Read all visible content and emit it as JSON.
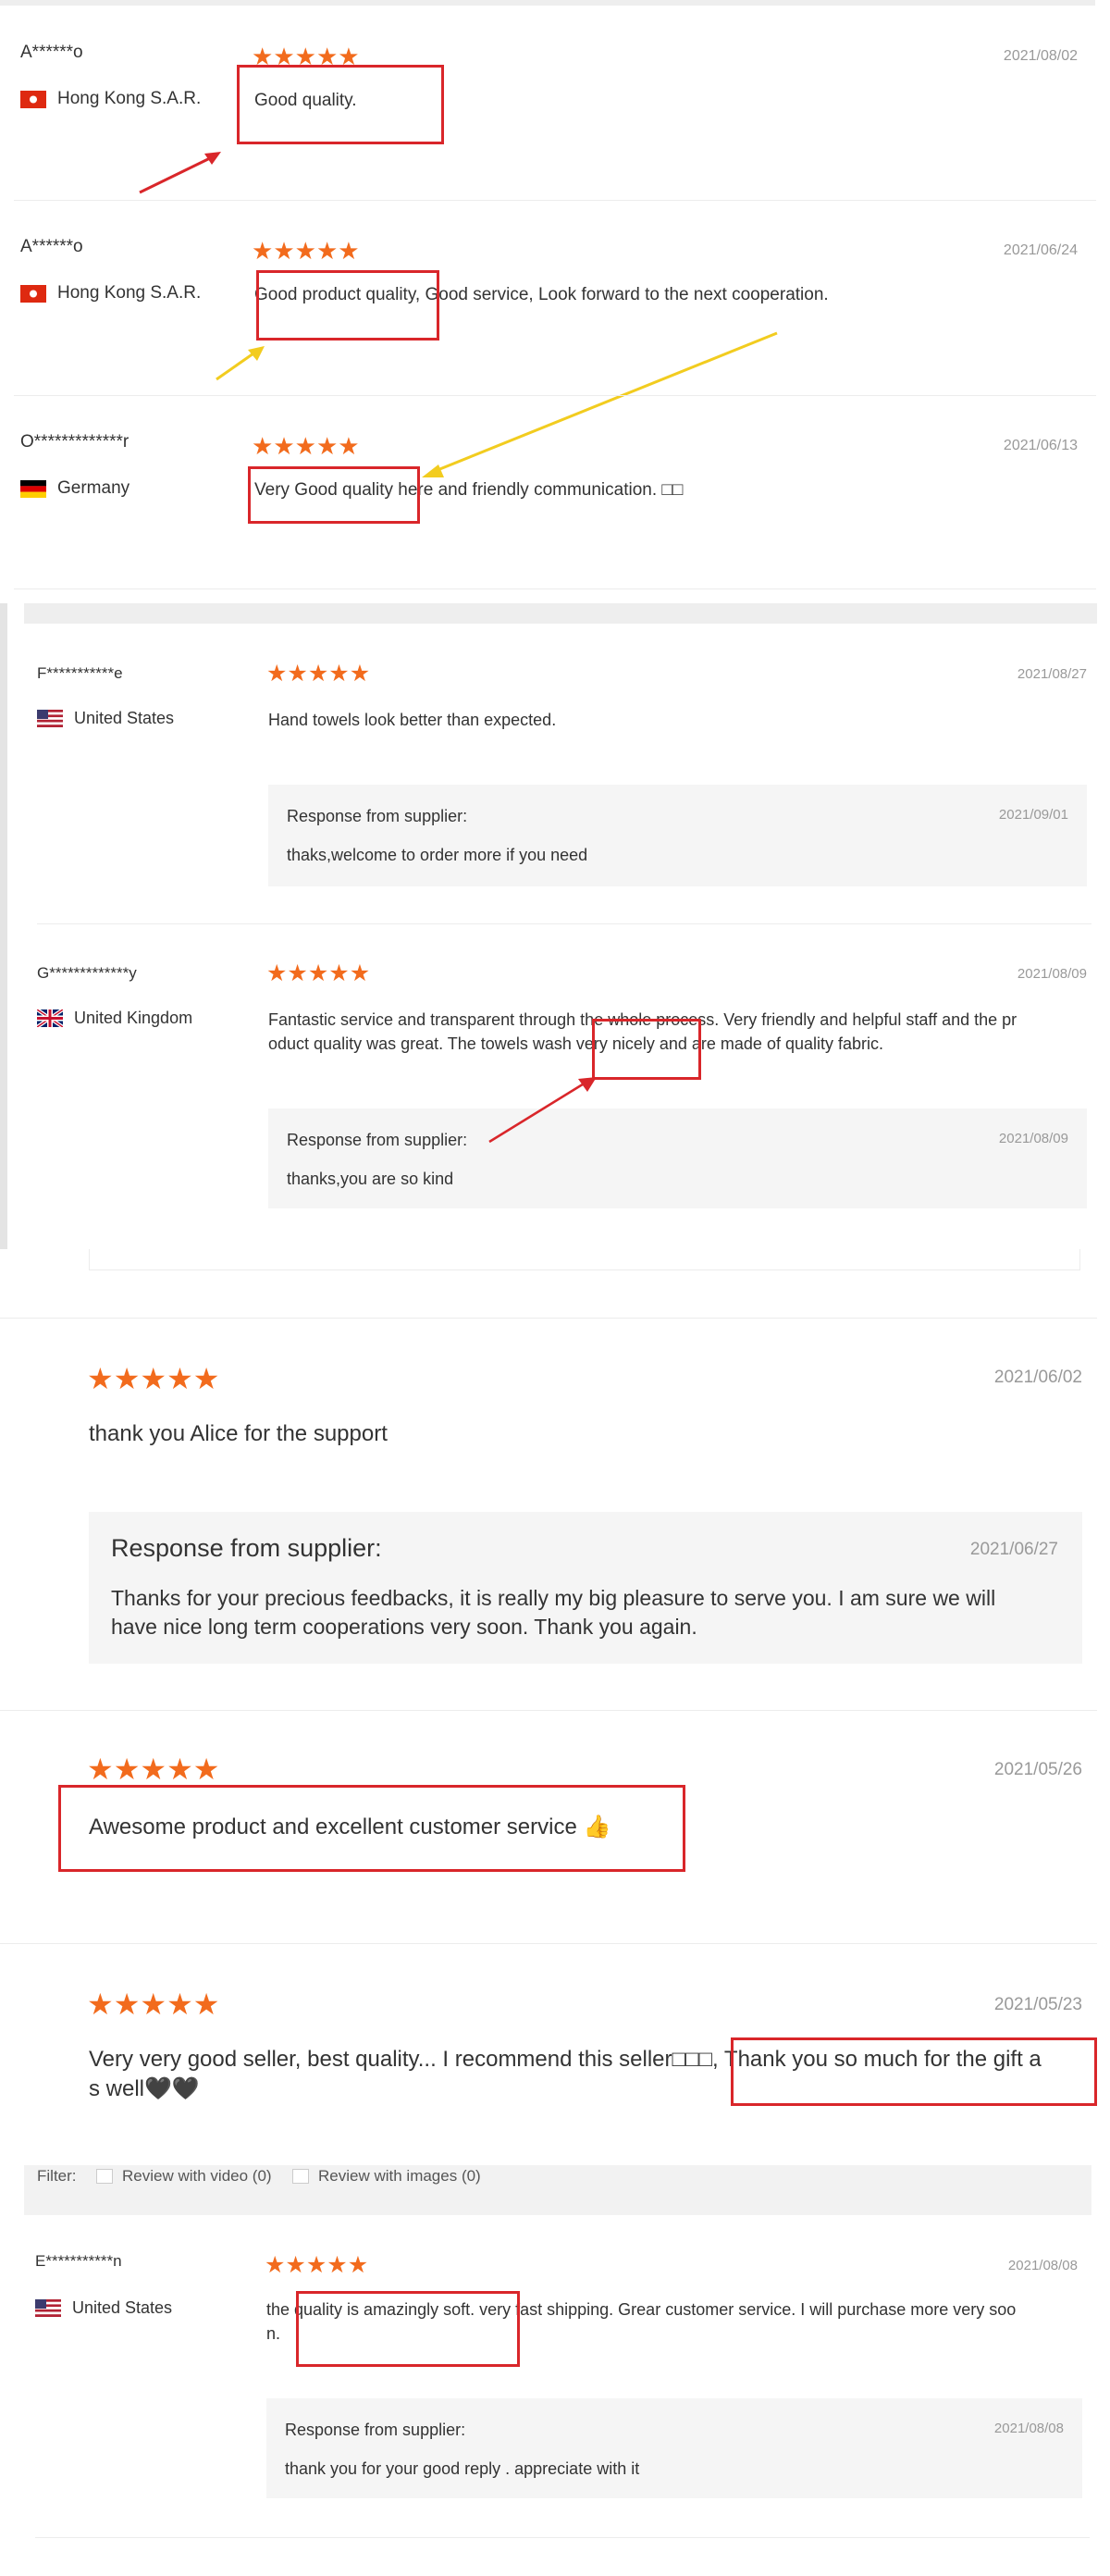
{
  "colors": {
    "star": "#f26b1d",
    "annotation_red": "#d9262a",
    "annotation_yellow": "#f2cc1f",
    "panel_bg": "#f5f5f5"
  },
  "section1": {
    "reviews": [
      {
        "name": "A******o",
        "country": "Hong Kong S.A.R.",
        "flag": "hong-kong-flag-icon",
        "date": "2021/08/02",
        "text": "Good quality.",
        "rating": 5
      },
      {
        "name": "A******o",
        "country": "Hong Kong S.A.R.",
        "flag": "hong-kong-flag-icon",
        "date": "2021/06/24",
        "text": "Good product quality, Good service, Look forward to the next cooperation.",
        "rating": 5
      },
      {
        "name": "O*************r",
        "country": "Germany",
        "flag": "germany-flag-icon",
        "date": "2021/06/13",
        "text": "Very Good quality here and friendly communication. □□",
        "rating": 5
      }
    ]
  },
  "section2": {
    "reviews": [
      {
        "name": "F***********e",
        "country": "United States",
        "flag": "usa-flag-icon",
        "date": "2021/08/27",
        "text": "Hand towels look better than expected.",
        "rating": 5,
        "response": {
          "label": "Response from supplier:",
          "date": "2021/09/01",
          "text": "thaks,welcome to order more if you need"
        }
      },
      {
        "name": "G*************y",
        "country": "United Kingdom",
        "flag": "uk-flag-icon",
        "date": "2021/08/09",
        "text_line1": "Fantastic service and transparent through the whole process. Very friendly and helpful staff and the pr",
        "text_line2": "oduct quality was great. The towels wash very nicely and are made of quality fabric.",
        "rating": 5,
        "response": {
          "label": "Response from supplier:",
          "date": "2021/08/09",
          "text": "thanks,you are so kind"
        }
      }
    ]
  },
  "section3": {
    "reviews": [
      {
        "date": "2021/06/02",
        "text": "thank you Alice for the support",
        "rating": 5,
        "response": {
          "label": "Response from supplier:",
          "date": "2021/06/27",
          "text_line1": "Thanks for your precious feedbacks, it is really my big pleasure to serve you. I am sure we will",
          "text_line2": "have nice long term cooperations very soon. Thank you again."
        }
      },
      {
        "date": "2021/05/26",
        "text": "Awesome product and excellent customer service 👍",
        "rating": 5
      },
      {
        "date": "2021/05/23",
        "text_line1_a": "Very very good seller, best quality... I recommend this seller□□□",
        "text_line1_b": ", Thank you so much for the gift a",
        "text_line2": "s well🖤🖤",
        "rating": 5
      }
    ]
  },
  "section4": {
    "filter": {
      "label": "Filter:",
      "option_video": "Review with video (0)",
      "option_images": "Review with images (0)"
    },
    "reviews": [
      {
        "name": "E***********n",
        "country": "United States",
        "flag": "usa-flag-icon",
        "date": "2021/08/08",
        "text_line1": "the quality is amazingly soft. very fast shipping. Grear customer service. I will purchase more very soo",
        "text_line2": "n.",
        "rating": 5,
        "response": {
          "label": "Response from supplier:",
          "date": "2021/08/08",
          "text": "thank you for your good reply . appreciate with it"
        }
      }
    ]
  }
}
